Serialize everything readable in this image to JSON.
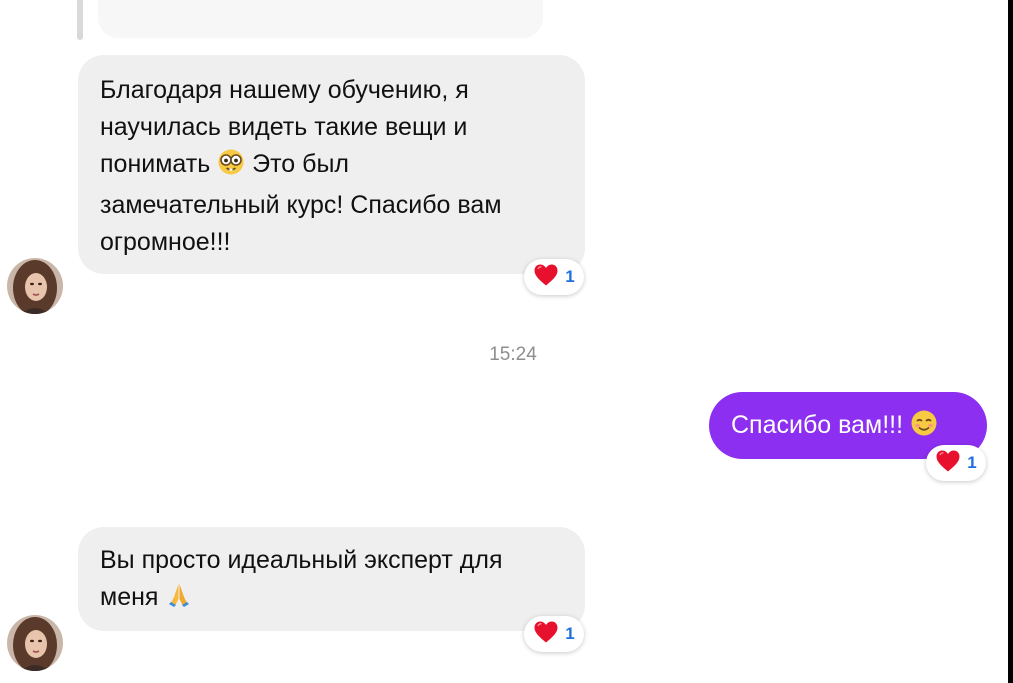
{
  "messages": [
    {
      "direction": "incoming",
      "lines": [
        "Благодаря нашему обучению, я",
        "научилась видеть такие вещи и",
        "понимать",
        "Это был",
        "замечательный курс! Спасибо вам",
        "огромное!!!"
      ],
      "inline_emoji": "nerd-glasses-face",
      "reaction": {
        "emoji": "red-heart",
        "count": "1"
      }
    },
    {
      "direction": "outgoing",
      "text": "Спасибо вам!!!",
      "inline_emoji": "smiling-face-with-smiling-eyes",
      "reaction": {
        "emoji": "red-heart",
        "count": "1"
      }
    },
    {
      "direction": "incoming",
      "lines": [
        "Вы просто идеальный эксперт для",
        "меня"
      ],
      "inline_emoji": "folded-hands",
      "reaction": {
        "emoji": "red-heart",
        "count": "1"
      }
    }
  ],
  "timestamp": "15:24",
  "colors": {
    "incoming_bubble": "#efefef",
    "outgoing_bubble": "#8c2ff0",
    "reaction_count": "#1f6fe0",
    "heart": "#e8112d",
    "timestamp": "#8e8e8e"
  }
}
